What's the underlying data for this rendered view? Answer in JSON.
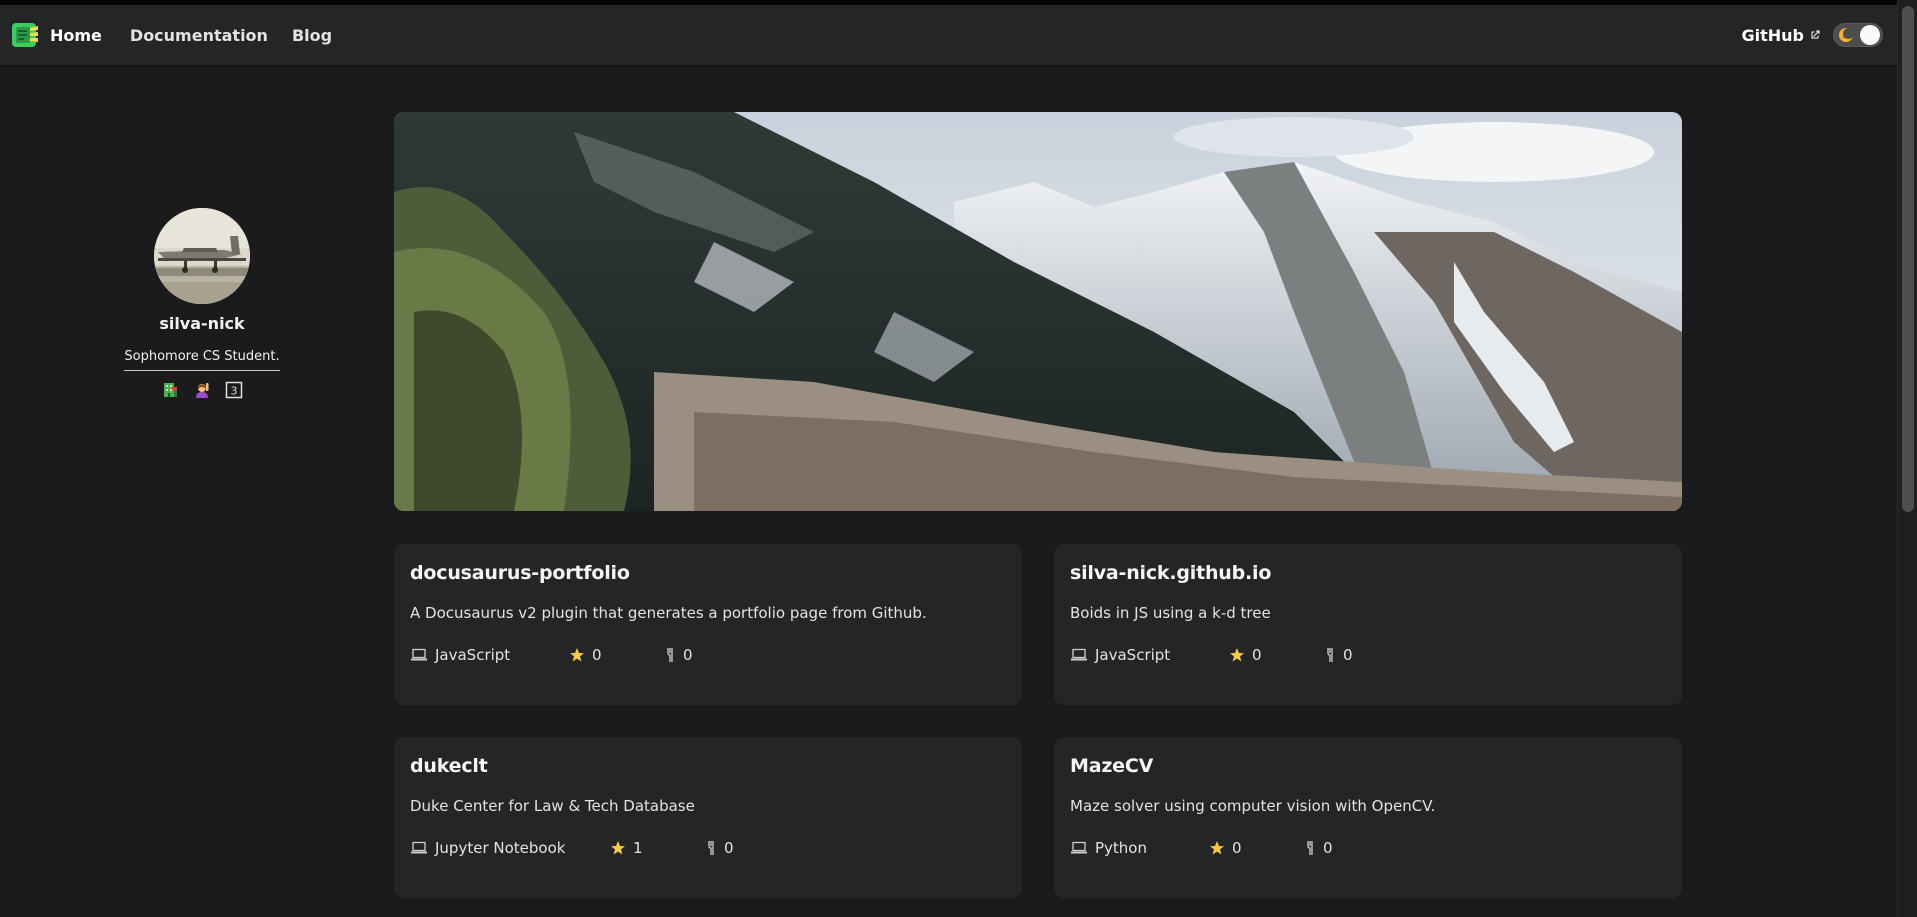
{
  "nav": {
    "home": "Home",
    "documentation": "Documentation",
    "blog": "Blog",
    "github": "GitHub"
  },
  "profile": {
    "username": "silva-nick",
    "bio": "Sophomore CS Student.",
    "icons": [
      "building-icon",
      "person-raising-hand-icon",
      "keycap-3-icon"
    ]
  },
  "repos": [
    {
      "name": "docusaurus-portfolio",
      "description": "A Docusaurus v2 plugin that generates a portfolio page from Github.",
      "language": "JavaScript",
      "stars": "0",
      "forks": "0"
    },
    {
      "name": "silva-nick.github.io",
      "description": "Boids in JS using a k-d tree",
      "language": "JavaScript",
      "stars": "0",
      "forks": "0"
    },
    {
      "name": "dukeclt",
      "description": "Duke Center for Law & Tech Database",
      "language": "Jupyter Notebook",
      "stars": "1",
      "forks": "0"
    },
    {
      "name": "MazeCV",
      "description": "Maze solver using computer vision with OpenCV.",
      "language": "Python",
      "stars": "0",
      "forks": "0"
    }
  ],
  "colors": {
    "background": "#1b1b1d",
    "surface": "#242526",
    "star": "#f7c948"
  }
}
